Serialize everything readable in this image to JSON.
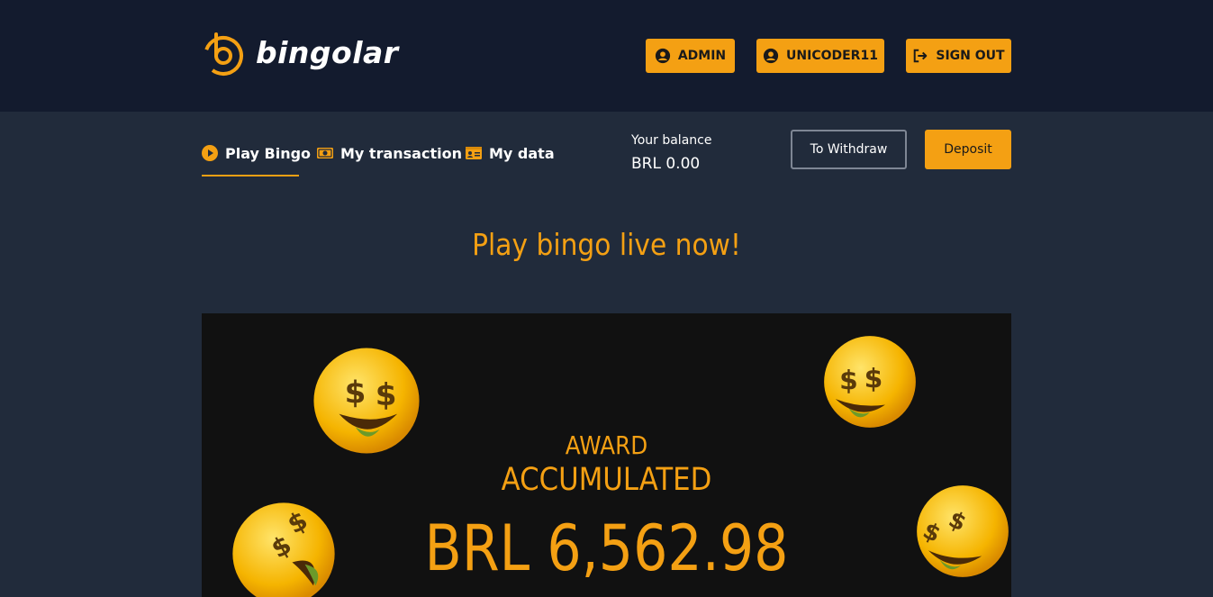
{
  "brand": {
    "name": "bingolar",
    "accent": "#f4a013"
  },
  "header": {
    "buttons": [
      {
        "label": "ADMIN",
        "icon": "user-circle-icon"
      },
      {
        "label": "UNICODER11",
        "icon": "user-circle-icon"
      },
      {
        "label": "SIGN OUT",
        "icon": "sign-out-icon"
      }
    ]
  },
  "nav": {
    "items": [
      {
        "label": "Play Bingo",
        "icon": "play-circle-icon",
        "active": true
      },
      {
        "label": "My transaction",
        "icon": "money-bill-icon"
      },
      {
        "label": "My data",
        "icon": "id-card-icon"
      }
    ]
  },
  "balance": {
    "label": "Your balance",
    "value": "BRL 0.00"
  },
  "actions": {
    "withdraw": "To Withdraw",
    "deposit": "Deposit"
  },
  "hero": {
    "headline": "Play bingo live now!",
    "award_line1": "AWARD",
    "award_line2": "ACCUMULATED",
    "amount": "BRL 6,562.98"
  }
}
